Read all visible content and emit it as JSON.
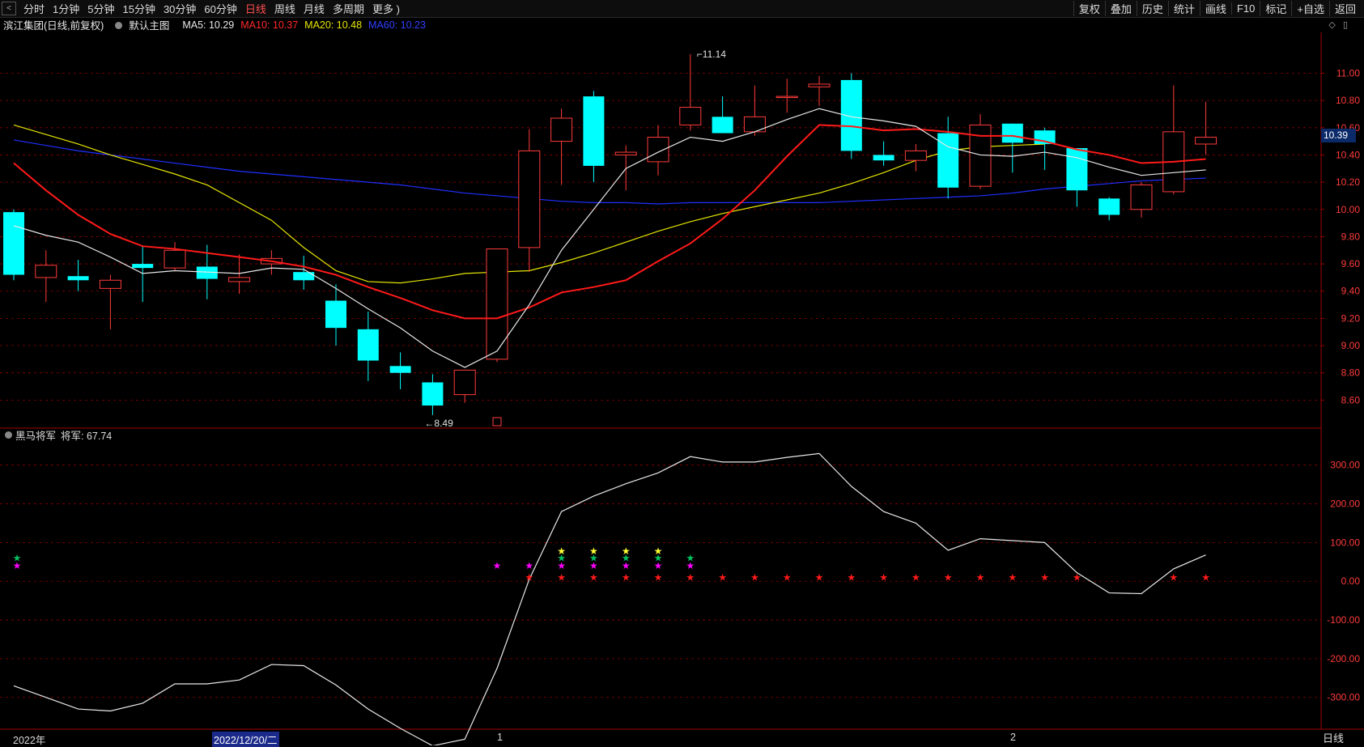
{
  "toolbar": {
    "back": "<",
    "periods": [
      "分时",
      "1分钟",
      "5分钟",
      "15分钟",
      "30分钟",
      "60分钟",
      "日线",
      "周线",
      "月线",
      "多周期",
      "更多 )"
    ],
    "active_period": "日线",
    "right": [
      "复权",
      "叠加",
      "历史",
      "统计",
      "画线",
      "F10",
      "标记",
      "+自选",
      "返回"
    ]
  },
  "main_info": {
    "stock": "滨江集团(日线,前复权)",
    "template": "默认主图",
    "ma5": "MA5: 10.29",
    "ma10": "MA10: 10.37",
    "ma20": "MA20: 10.48",
    "ma60": "MA60: 10.23"
  },
  "ind_info": {
    "name": "黑马将军",
    "value": "将军: 67.74"
  },
  "price_tag": "10.39",
  "period_tag": "日线",
  "x_labels": [
    "2022年",
    "2022/12/20/二",
    "1",
    "2"
  ],
  "colors": {
    "up": "#ff3b3b",
    "down": "#00ffff",
    "ma5": "#e8e8e8",
    "ma10": "#ff1a1a",
    "ma20": "#e6e600",
    "ma60": "#1f2fff",
    "ind_line": "#e8e8e8",
    "grid": "#8b0000"
  },
  "chart_data": [
    {
      "type": "candlestick",
      "title": "",
      "ylim": [
        8.4,
        11.3
      ],
      "y_ticks": [
        8.6,
        8.8,
        9.0,
        9.2,
        9.4,
        9.6,
        9.8,
        10.0,
        10.2,
        10.4,
        10.6,
        10.8,
        11.0
      ],
      "annotations": [
        {
          "text": "11.14",
          "at_index": 21
        },
        {
          "text": "8.49",
          "at_index": 13
        }
      ],
      "candles": [
        {
          "o": 9.98,
          "h": 10.0,
          "l": 9.48,
          "c": 9.52
        },
        {
          "o": 9.5,
          "h": 9.7,
          "l": 9.32,
          "c": 9.59
        },
        {
          "o": 9.51,
          "h": 9.63,
          "l": 9.4,
          "c": 9.48
        },
        {
          "o": 9.42,
          "h": 9.52,
          "l": 9.12,
          "c": 9.48
        },
        {
          "o": 9.6,
          "h": 9.73,
          "l": 9.32,
          "c": 9.57
        },
        {
          "o": 9.57,
          "h": 9.76,
          "l": 9.55,
          "c": 9.7
        },
        {
          "o": 9.58,
          "h": 9.74,
          "l": 9.34,
          "c": 9.49
        },
        {
          "o": 9.47,
          "h": 9.67,
          "l": 9.38,
          "c": 9.5
        },
        {
          "o": 9.6,
          "h": 9.7,
          "l": 9.52,
          "c": 9.64
        },
        {
          "o": 9.54,
          "h": 9.66,
          "l": 9.41,
          "c": 9.48
        },
        {
          "o": 9.33,
          "h": 9.45,
          "l": 9.0,
          "c": 9.13
        },
        {
          "o": 9.12,
          "h": 9.25,
          "l": 8.74,
          "c": 8.89
        },
        {
          "o": 8.85,
          "h": 8.95,
          "l": 8.68,
          "c": 8.8
        },
        {
          "o": 8.73,
          "h": 8.79,
          "l": 8.49,
          "c": 8.56
        },
        {
          "o": 8.64,
          "h": 8.82,
          "l": 8.58,
          "c": 8.82
        },
        {
          "o": 8.9,
          "h": 9.71,
          "l": 8.88,
          "c": 9.71
        },
        {
          "o": 9.72,
          "h": 10.59,
          "l": 9.54,
          "c": 10.43
        },
        {
          "o": 10.5,
          "h": 10.74,
          "l": 10.18,
          "c": 10.67
        },
        {
          "o": 10.83,
          "h": 10.87,
          "l": 10.2,
          "c": 10.32
        },
        {
          "o": 10.4,
          "h": 10.47,
          "l": 10.14,
          "c": 10.42
        },
        {
          "o": 10.35,
          "h": 10.62,
          "l": 10.25,
          "c": 10.53
        },
        {
          "o": 10.62,
          "h": 11.14,
          "l": 10.58,
          "c": 10.75
        },
        {
          "o": 10.68,
          "h": 10.83,
          "l": 10.56,
          "c": 10.56
        },
        {
          "o": 10.57,
          "h": 10.91,
          "l": 10.54,
          "c": 10.68
        },
        {
          "o": 10.83,
          "h": 10.96,
          "l": 10.71,
          "c": 10.83
        },
        {
          "o": 10.9,
          "h": 10.98,
          "l": 10.76,
          "c": 10.92
        },
        {
          "o": 10.95,
          "h": 11.0,
          "l": 10.37,
          "c": 10.43
        },
        {
          "o": 10.4,
          "h": 10.5,
          "l": 10.32,
          "c": 10.36
        },
        {
          "o": 10.36,
          "h": 10.48,
          "l": 10.28,
          "c": 10.43
        },
        {
          "o": 10.56,
          "h": 10.68,
          "l": 10.08,
          "c": 10.16
        },
        {
          "o": 10.17,
          "h": 10.7,
          "l": 10.15,
          "c": 10.62
        },
        {
          "o": 10.63,
          "h": 10.63,
          "l": 10.27,
          "c": 10.49
        },
        {
          "o": 10.58,
          "h": 10.6,
          "l": 10.29,
          "c": 10.48
        },
        {
          "o": 10.45,
          "h": 10.45,
          "l": 10.02,
          "c": 10.14
        },
        {
          "o": 10.08,
          "h": 10.09,
          "l": 9.92,
          "c": 9.96
        },
        {
          "o": 10.0,
          "h": 10.2,
          "l": 9.94,
          "c": 10.18
        },
        {
          "o": 10.13,
          "h": 10.91,
          "l": 10.11,
          "c": 10.57
        },
        {
          "o": 10.48,
          "h": 10.79,
          "l": 10.4,
          "c": 10.53
        }
      ],
      "series": [
        {
          "name": "MA5",
          "values": [
            9.88,
            9.81,
            9.76,
            9.65,
            9.53,
            9.55,
            9.54,
            9.53,
            9.57,
            9.56,
            9.42,
            9.27,
            9.13,
            8.96,
            8.84,
            8.96,
            9.3,
            9.7,
            10.0,
            10.3,
            10.42,
            10.53,
            10.5,
            10.57,
            10.66,
            10.74,
            10.68,
            10.65,
            10.61,
            10.46,
            10.4,
            10.39,
            10.42,
            10.38,
            10.31,
            10.25,
            10.27,
            10.29
          ]
        },
        {
          "name": "MA10",
          "values": [
            10.34,
            10.14,
            9.96,
            9.82,
            9.73,
            9.71,
            9.68,
            9.65,
            9.62,
            9.58,
            9.52,
            9.43,
            9.35,
            9.26,
            9.2,
            9.2,
            9.28,
            9.39,
            9.43,
            9.48,
            9.62,
            9.75,
            9.93,
            10.14,
            10.39,
            10.62,
            10.61,
            10.58,
            10.59,
            10.57,
            10.54,
            10.54,
            10.5,
            10.44,
            10.4,
            10.34,
            10.35,
            10.37
          ]
        },
        {
          "name": "MA20",
          "values": [
            10.62,
            10.55,
            10.48,
            10.4,
            10.33,
            10.26,
            10.18,
            10.05,
            9.92,
            9.72,
            9.55,
            9.47,
            9.46,
            9.49,
            9.53,
            9.54,
            9.55,
            9.61,
            9.68,
            9.76,
            9.84,
            9.91,
            9.97,
            10.02,
            10.07,
            10.12,
            10.19,
            10.27,
            10.36,
            10.43,
            10.46,
            10.47,
            10.48
          ]
        },
        {
          "name": "MA60",
          "values": [
            10.51,
            10.47,
            10.43,
            10.4,
            10.37,
            10.34,
            10.31,
            10.28,
            10.26,
            10.24,
            10.22,
            10.2,
            10.18,
            10.15,
            10.12,
            10.1,
            10.08,
            10.06,
            10.05,
            10.05,
            10.04,
            10.05,
            10.05,
            10.05,
            10.05,
            10.05,
            10.06,
            10.07,
            10.08,
            10.09,
            10.1,
            10.12,
            10.15,
            10.17,
            10.19,
            10.21,
            10.22,
            10.23
          ]
        }
      ]
    },
    {
      "type": "line",
      "title": "",
      "ylim": [
        -380,
        360
      ],
      "y_ticks": [
        -300,
        -200,
        -100,
        0,
        100,
        200,
        300
      ],
      "series": [
        {
          "name": "将军",
          "values": [
            -270,
            -300,
            -330,
            -335,
            -315,
            -265,
            -265,
            -255,
            -215,
            -218,
            -268,
            -330,
            -380,
            -425,
            -408,
            -225,
            5,
            180,
            220,
            252,
            280,
            322,
            308,
            308,
            320,
            330,
            245,
            180,
            150,
            80,
            110,
            105,
            100,
            22,
            -30,
            -32,
            32,
            68
          ]
        }
      ],
      "signals": {
        "red": [
          16,
          17,
          18,
          19,
          20,
          21,
          22,
          23,
          24,
          25,
          26,
          27,
          28,
          29,
          30,
          31,
          32,
          33,
          36,
          37
        ],
        "magenta": [
          0,
          15,
          16,
          17,
          18,
          19,
          20,
          21
        ],
        "green": [
          0,
          17,
          18,
          19,
          20,
          21
        ],
        "yellow": [
          17,
          18,
          19,
          20
        ]
      }
    }
  ]
}
